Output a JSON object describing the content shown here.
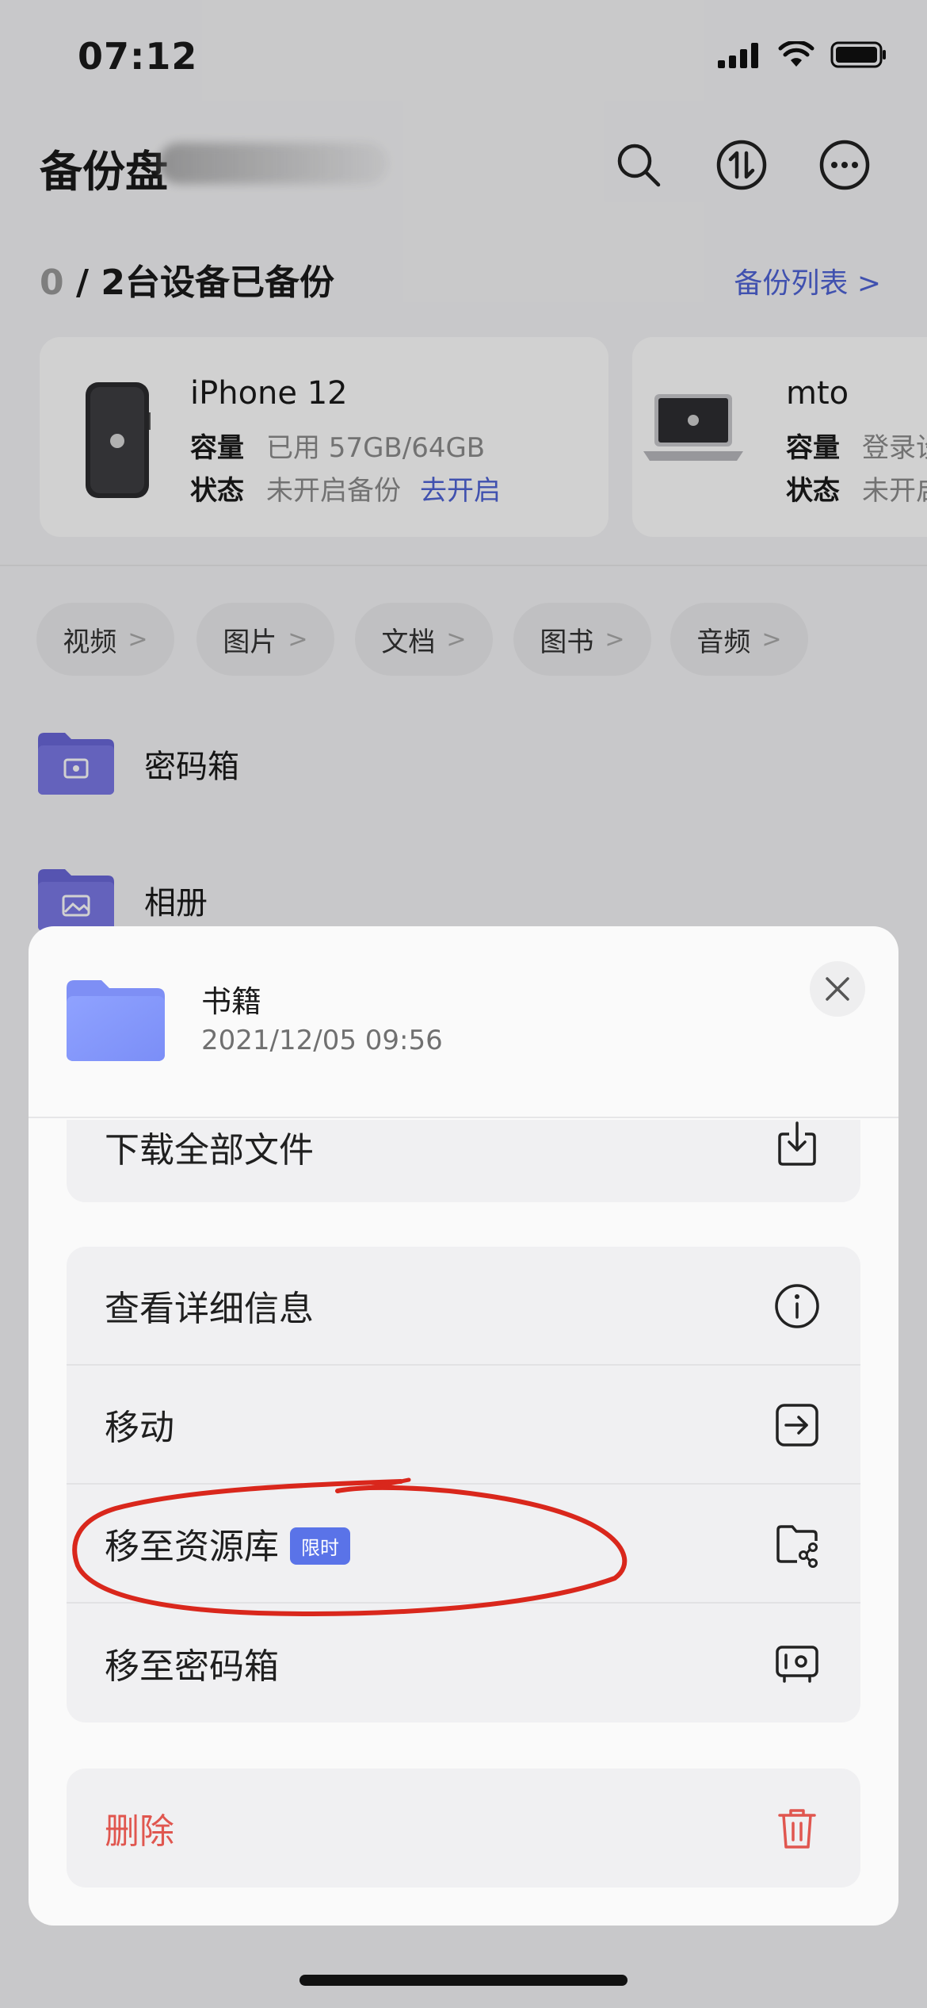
{
  "status_bar": {
    "time": "07:12"
  },
  "header": {
    "title": "备份盘"
  },
  "backup": {
    "count_done": "0",
    "count_rest": " / 2台设备已备份",
    "list_link": "备份列表 >"
  },
  "devices": [
    {
      "name": "iPhone 12",
      "capacity_label": "容量",
      "capacity_value": "已用 57GB/64GB",
      "status_label": "状态",
      "status_value": "未开启备份",
      "action": "去开启"
    },
    {
      "name": "mto",
      "capacity_label": "容量",
      "capacity_value": "登录设",
      "status_label": "状态",
      "status_value": "未开启"
    }
  ],
  "categories": [
    "视频",
    "图片",
    "文档",
    "图书",
    "音频"
  ],
  "chevron": ">",
  "folders": [
    {
      "name": "密码箱"
    },
    {
      "name": "相册"
    }
  ],
  "sheet": {
    "folder_name": "书籍",
    "folder_date": "2021/12/05 09:56",
    "download_all": "下载全部文件",
    "details": "查看详细信息",
    "move": "移动",
    "move_to_library": "移至资源库",
    "limited_badge": "限时",
    "move_to_vault": "移至密码箱",
    "delete": "删除"
  },
  "colors": {
    "accent": "#4f63d6",
    "danger": "#e0564f",
    "annotation": "#d9271c"
  }
}
